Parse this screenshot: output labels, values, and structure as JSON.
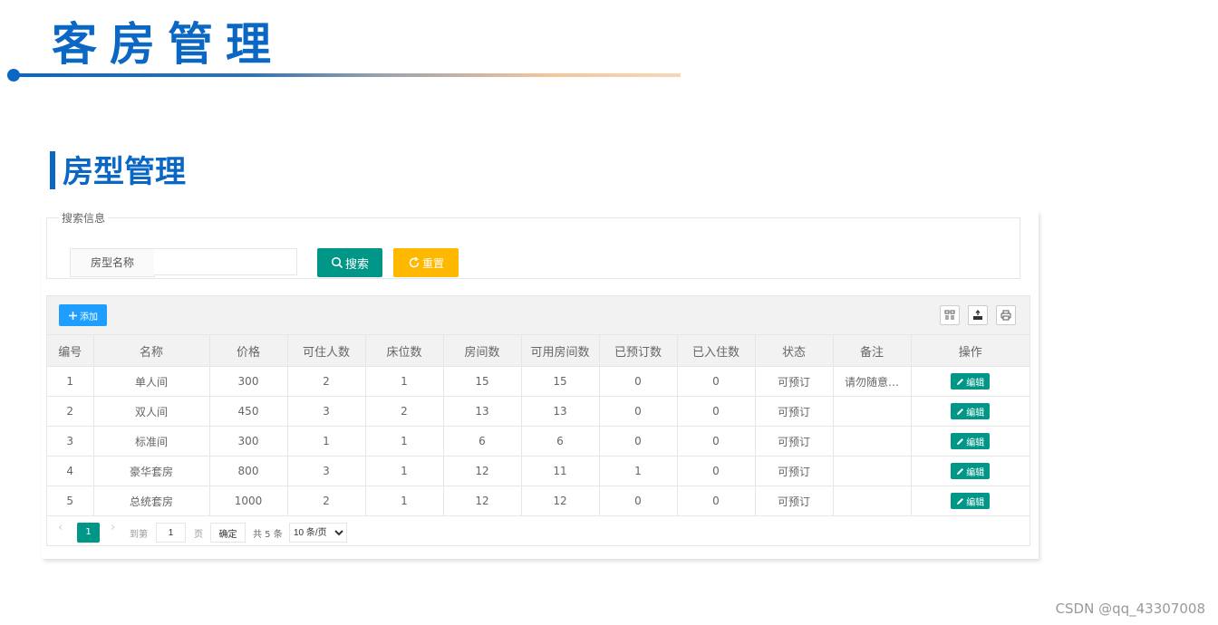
{
  "slide": {
    "title": "客房管理"
  },
  "section": {
    "title": "房型管理"
  },
  "search": {
    "legend": "搜索信息",
    "field_label": "房型名称",
    "field_value": "",
    "search_label": "搜索",
    "reset_label": "重置"
  },
  "toolbar": {
    "add_label": "添加"
  },
  "table": {
    "columns": [
      "编号",
      "名称",
      "价格",
      "可住人数",
      "床位数",
      "房间数",
      "可用房间数",
      "已预订数",
      "已入住数",
      "状态",
      "备注",
      "操作"
    ],
    "edit_label": "编辑",
    "rows": [
      [
        "1",
        "单人间",
        "300",
        "2",
        "1",
        "15",
        "15",
        "0",
        "0",
        "可预订",
        "请勿随意…"
      ],
      [
        "2",
        "双人间",
        "450",
        "3",
        "2",
        "13",
        "13",
        "0",
        "0",
        "可预订",
        ""
      ],
      [
        "3",
        "标准间",
        "300",
        "1",
        "1",
        "6",
        "6",
        "0",
        "0",
        "可预订",
        ""
      ],
      [
        "4",
        "豪华套房",
        "800",
        "3",
        "1",
        "12",
        "11",
        "1",
        "0",
        "可预订",
        ""
      ],
      [
        "5",
        "总统套房",
        "1000",
        "2",
        "1",
        "12",
        "12",
        "0",
        "0",
        "可预订",
        ""
      ]
    ]
  },
  "pager": {
    "current": "1",
    "goto_label": "到第",
    "page_value": "1",
    "page_unit": "页",
    "confirm_label": "确定",
    "total_label": "共 5 条",
    "page_size": "10 条/页"
  },
  "watermark": "CSDN @qq_43307008"
}
